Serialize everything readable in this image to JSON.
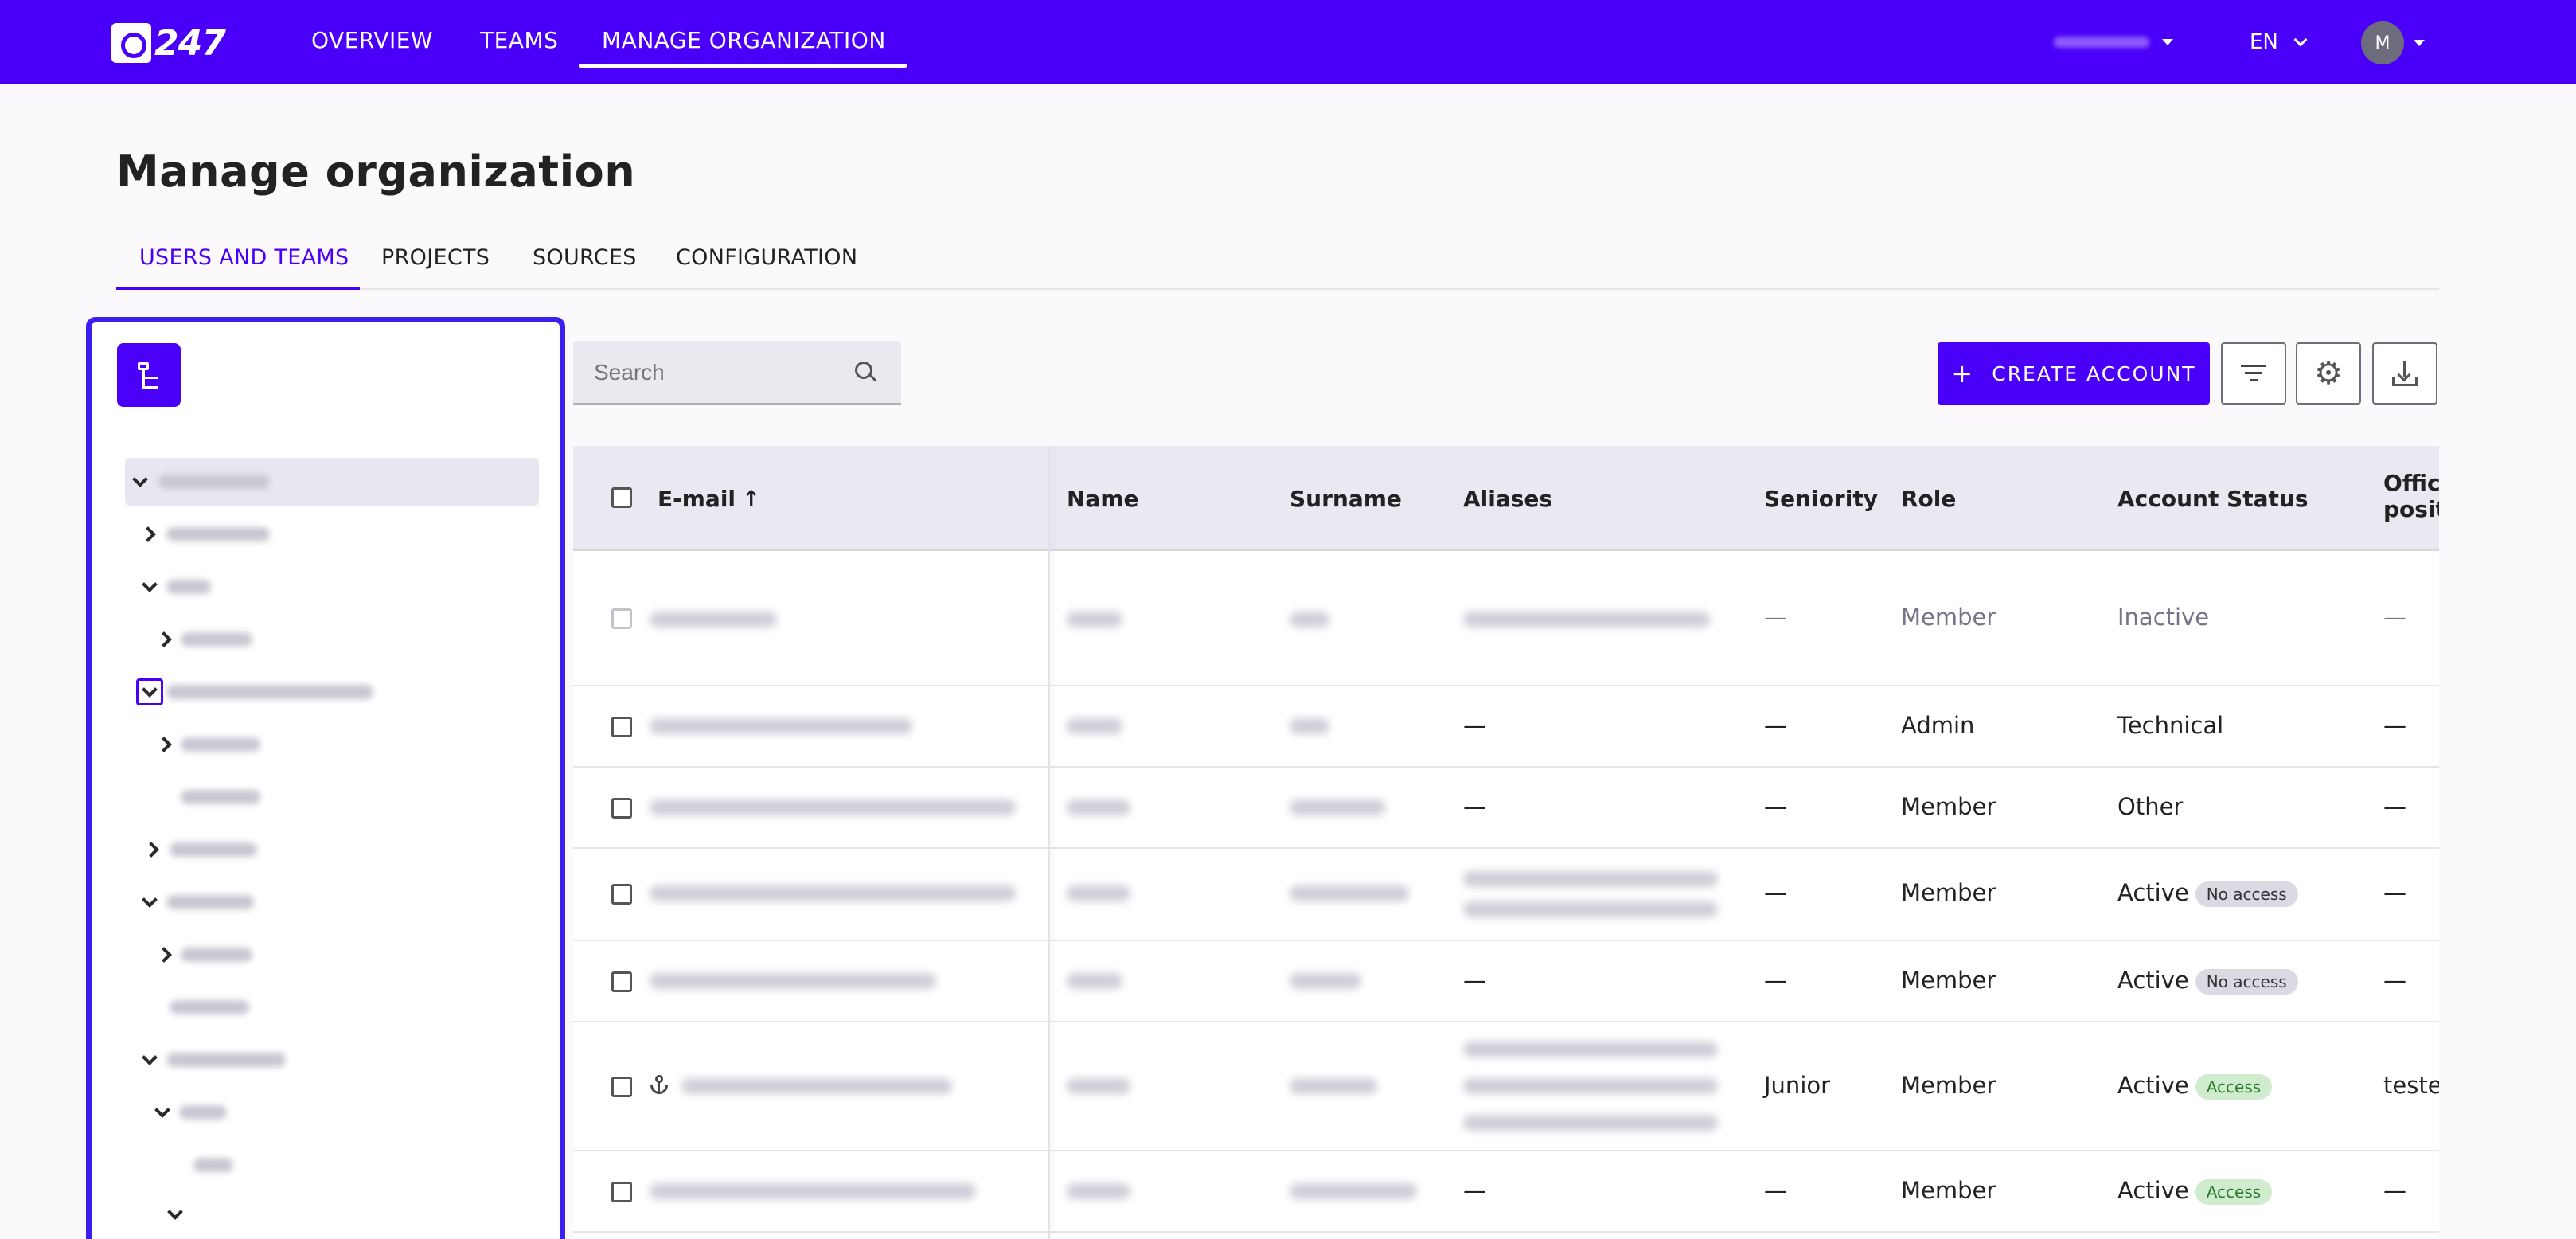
{
  "brand": {
    "logo_text": "247"
  },
  "nav": {
    "items": [
      "OVERVIEW",
      "TEAMS",
      "MANAGE ORGANIZATION"
    ],
    "active": "MANAGE ORGANIZATION",
    "language": "EN",
    "avatar_initial": "M"
  },
  "page": {
    "title": "Manage organization",
    "tabs": [
      "USERS AND TEAMS",
      "PROJECTS",
      "SOURCES",
      "CONFIGURATION"
    ],
    "active_tab": "USERS AND TEAMS"
  },
  "toolbar": {
    "search_placeholder": "Search",
    "create_label": "CREATE ACCOUNT",
    "create_icon": "+"
  },
  "table": {
    "headers": {
      "email": "E-mail",
      "email_sort": "↑",
      "name": "Name",
      "surname": "Surname",
      "aliases": "Aliases",
      "seniority": "Seniority",
      "role": "Role",
      "account_status": "Account Status",
      "official_position_1": "Offici",
      "official_position_2": "positi"
    },
    "rows": [
      {
        "aliases": "",
        "seniority": "—",
        "role": "Member",
        "status": "Inactive",
        "badge": "",
        "position": "—"
      },
      {
        "aliases": "—",
        "seniority": "—",
        "role": "Admin",
        "status": "Technical",
        "badge": "",
        "position": "—"
      },
      {
        "aliases": "—",
        "seniority": "—",
        "role": "Member",
        "status": "Other",
        "badge": "",
        "position": "—"
      },
      {
        "aliases": "",
        "seniority": "—",
        "role": "Member",
        "status": "Active",
        "badge": "No access",
        "position": "—"
      },
      {
        "aliases": "—",
        "seniority": "—",
        "role": "Member",
        "status": "Active",
        "badge": "No access",
        "position": "—"
      },
      {
        "aliases": "",
        "seniority": "Junior",
        "role": "Member",
        "status": "Active",
        "badge": "Access",
        "position": "teste"
      },
      {
        "aliases": "—",
        "seniority": "—",
        "role": "Member",
        "status": "Active",
        "badge": "Access",
        "position": "—"
      }
    ]
  },
  "colors": {
    "brand": "#4a00f8",
    "highlight_border": "#3b1ef0",
    "access_badge": "#cfeccf",
    "no_access_badge": "#dcd9e3"
  },
  "icons": [
    "logo-q-icon",
    "chevron-down-icon",
    "tree-structure-icon",
    "search-icon",
    "filter-icon",
    "gear-icon",
    "download-icon",
    "anchor-icon",
    "sort-up-arrow-icon"
  ]
}
